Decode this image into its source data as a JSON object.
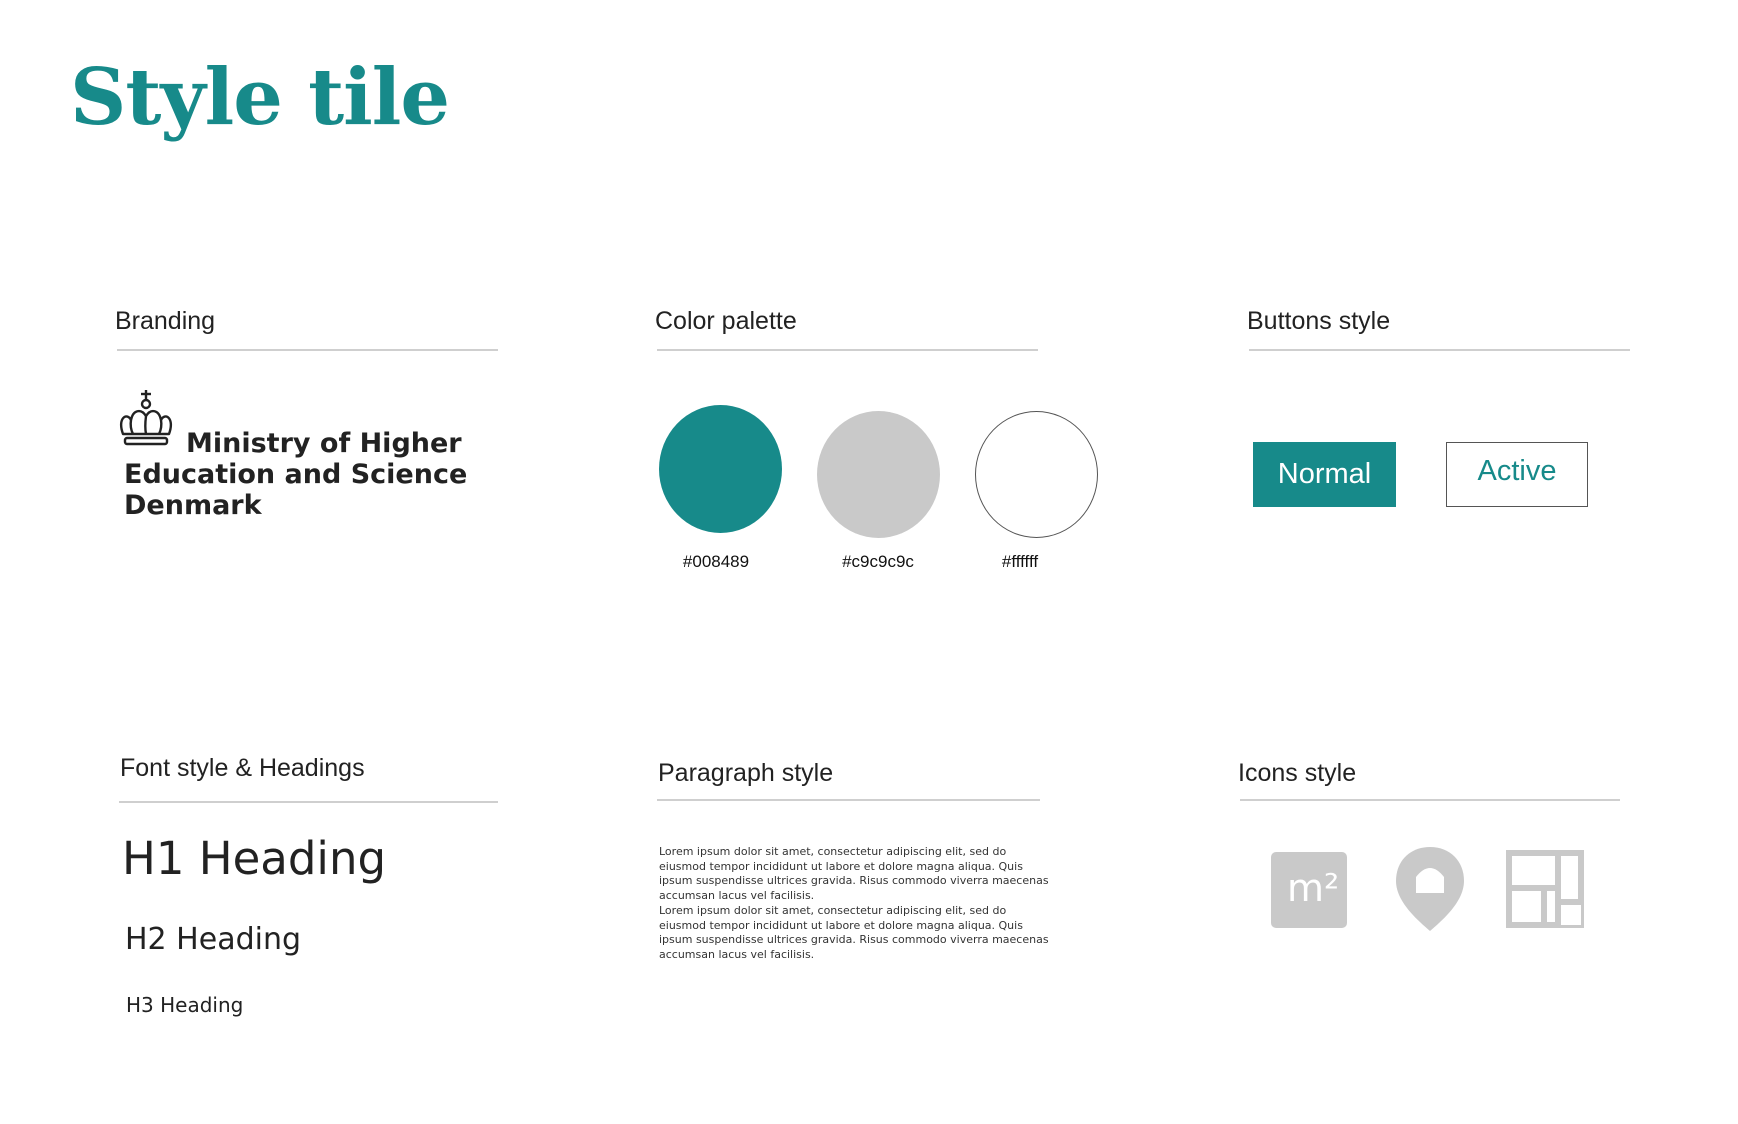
{
  "page": {
    "title": "Style tile"
  },
  "branding": {
    "heading": "Branding",
    "logo_lines": [
      "Ministry of Higher",
      "Education and Science",
      "Denmark"
    ]
  },
  "palette": {
    "heading": "Color palette",
    "colors": [
      {
        "hex": "#008489",
        "label": "#008489"
      },
      {
        "hex": "#c9c9c9",
        "label": "#c9c9c9c"
      },
      {
        "hex": "#ffffff",
        "label": "#ffffff"
      }
    ]
  },
  "buttons": {
    "heading": "Buttons style",
    "normal_label": "Normal",
    "active_label": "Active"
  },
  "fonts": {
    "heading": "Font style & Headings",
    "h1": "H1 Heading",
    "h2": "H2 Heading",
    "h3": "H3 Heading"
  },
  "paragraph": {
    "heading": "Paragraph style",
    "lines": [
      "Lorem ipsum dolor sit amet, consectetur adipiscing elit, sed do eiusmod tempor incididunt ut labore et dolore magna aliqua. Quis ipsum suspendisse ultrices gravida. Risus commodo viverra maecenas accumsan lacus vel facilisis.",
      "Lorem ipsum dolor sit amet, consectetur adipiscing elit, sed do eiusmod tempor incididunt ut labore et dolore magna aliqua. Quis ipsum suspendisse ultrices gravida. Risus commodo viverra maecenas accumsan lacus vel facilisis."
    ]
  },
  "icons": {
    "heading": "Icons style",
    "items": [
      {
        "name": "square-meter-icon",
        "label": "m²"
      },
      {
        "name": "location-home-icon"
      },
      {
        "name": "floor-plan-icon"
      }
    ],
    "color": "#c9c9c9"
  },
  "theme": {
    "accent": "#178a8a",
    "rule": "#cfcfcf"
  }
}
